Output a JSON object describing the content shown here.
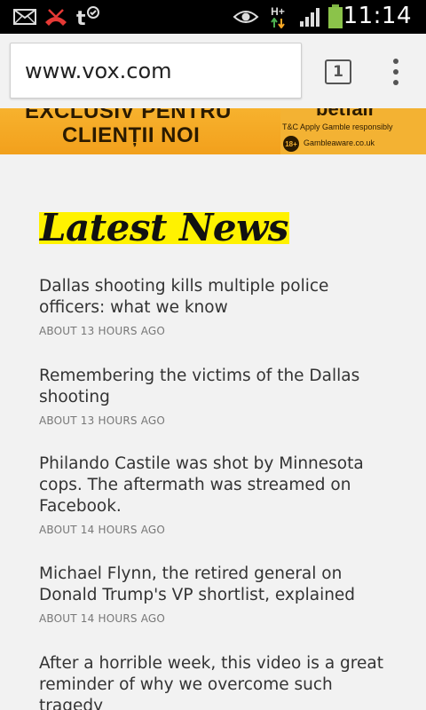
{
  "status_bar": {
    "icons": [
      "mail-icon",
      "missed-call-icon",
      "tmobile-icon",
      "eye-icon",
      "hplus-data-icon",
      "signal-icon",
      "battery-icon"
    ],
    "data_label": "H+",
    "time": "11:14"
  },
  "browser": {
    "url": "www.vox.com",
    "tab_count": "1"
  },
  "ad": {
    "line1": "EXCLUSIV PENTRU",
    "line2": "CLIENȚII NOI",
    "brand": "betfair",
    "terms": "T&C Apply Gamble responsibly",
    "age": "18+",
    "aware": "Gambleaware.co.uk",
    "accent": "#f5a623"
  },
  "section": {
    "title": "Latest News",
    "highlight": "#fff200"
  },
  "news": [
    {
      "headline_lines": [
        "Dallas shooting kills multiple police",
        "officers: what we know"
      ],
      "time": "ABOUT 13 HOURS AGO"
    },
    {
      "headline_lines": [
        "Remembering the victims of the Dallas",
        "shooting"
      ],
      "time": "ABOUT 13 HOURS AGO"
    },
    {
      "headline_lines": [
        "Philando Castile was shot by Minnesota",
        "cops. The aftermath was streamed on",
        "Facebook."
      ],
      "time": "ABOUT 14 HOURS AGO"
    },
    {
      "headline_lines": [
        "Michael Flynn, the retired general on",
        "Donald Trump's VP shortlist, explained"
      ],
      "time": "ABOUT 14 HOURS AGO"
    },
    {
      "headline_lines": [
        "After a horrible week, this video is a great",
        "reminder of why we overcome such",
        "tragedy"
      ],
      "time": ""
    }
  ]
}
